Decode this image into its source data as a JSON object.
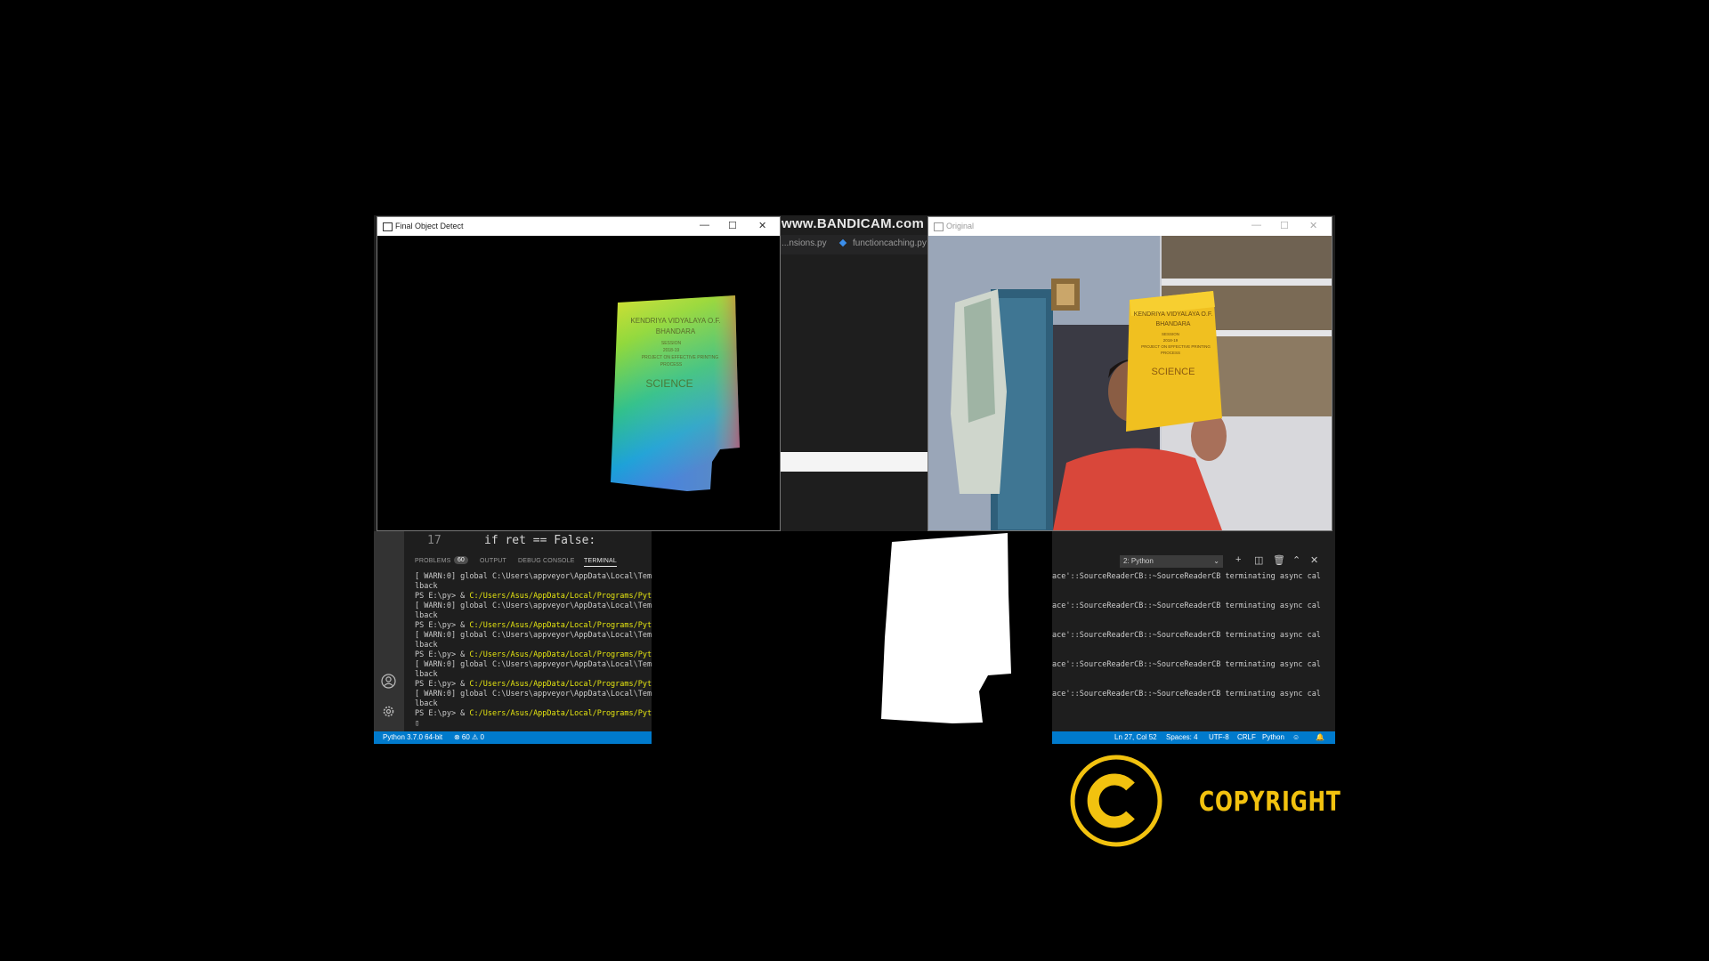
{
  "watermark": "www.BANDICAM.com",
  "editor": {
    "tabs": [
      "...nsions.py",
      "functioncaching.py"
    ],
    "code_line_number": "17",
    "code_line": "if ret == False:"
  },
  "windows": {
    "final": {
      "title": "Final Object Detect",
      "controls": [
        "—",
        "☐",
        "✕"
      ]
    },
    "original": {
      "title": "Original",
      "controls": [
        "—",
        "☐",
        "✕"
      ]
    }
  },
  "book": {
    "title_line1": "KENDRIYA VIDYALAYA O.F.",
    "title_line2": "BHANDARA",
    "small1": "SESSION",
    "small2": "2018-19",
    "small3": "PROJECT ON EFFECTIVE PRINTING",
    "small4": "PROCESS",
    "subject": "SCIENCE"
  },
  "panel": {
    "tabs": {
      "problems": "PROBLEMS",
      "problems_count": "60",
      "output": "OUTPUT",
      "debug": "DEBUG CONSOLE",
      "terminal": "TERMINAL"
    },
    "terminal_select": "2: Python",
    "terminal_left": [
      {
        "a": "[ WARN:0] global C:\\Users\\appveyor\\AppData\\Local\\Tem",
        "b": ""
      },
      {
        "a": "lback",
        "b": ""
      },
      {
        "a": "PS E:\\py> & ",
        "b": "C:/Users/Asus/AppData/Local/Programs/Pyt"
      },
      {
        "a": "[ WARN:0] global C:\\Users\\appveyor\\AppData\\Local\\Tem",
        "b": ""
      },
      {
        "a": "lback",
        "b": ""
      },
      {
        "a": "PS E:\\py> & ",
        "b": "C:/Users/Asus/AppData/Local/Programs/Pyt"
      },
      {
        "a": "[ WARN:0] global C:\\Users\\appveyor\\AppData\\Local\\Tem",
        "b": ""
      },
      {
        "a": "lback",
        "b": ""
      },
      {
        "a": "PS E:\\py> & ",
        "b": "C:/Users/Asus/AppData/Local/Programs/Pyt"
      },
      {
        "a": "[ WARN:0] global C:\\Users\\appveyor\\AppData\\Local\\Tem",
        "b": ""
      },
      {
        "a": "lback",
        "b": ""
      },
      {
        "a": "PS E:\\py> & ",
        "b": "C:/Users/Asus/AppData/Local/Programs/Pyt"
      },
      {
        "a": "[ WARN:0] global C:\\Users\\appveyor\\AppData\\Local\\Tem",
        "b": ""
      },
      {
        "a": "lback",
        "b": ""
      },
      {
        "a": "PS E:\\py> & ",
        "b": "C:/Users/Asus/AppData/Local/Programs/Pyt"
      },
      {
        "a": "▯",
        "b": ""
      }
    ],
    "terminal_right": [
      "ace'::SourceReaderCB::~SourceReaderCB terminating async cal",
      "",
      "",
      "ace'::SourceReaderCB::~SourceReaderCB terminating async cal",
      "",
      "",
      "ace'::SourceReaderCB::~SourceReaderCB terminating async cal",
      "",
      "",
      "ace'::SourceReaderCB::~SourceReaderCB terminating async cal",
      "",
      "",
      "ace'::SourceReaderCB::~SourceReaderCB terminating async cal"
    ]
  },
  "status": {
    "python": "Python 3.7.0 64-bit",
    "errors": "⊗ 60 ⚠ 0",
    "position": "Ln 27, Col 52",
    "spaces": "Spaces: 4",
    "encoding": "UTF-8",
    "eol": "CRLF",
    "language": "Python"
  },
  "copyright": "COPYRIGHT",
  "colors": {
    "accent": "#007acc",
    "copyright": "#f2c20f"
  }
}
